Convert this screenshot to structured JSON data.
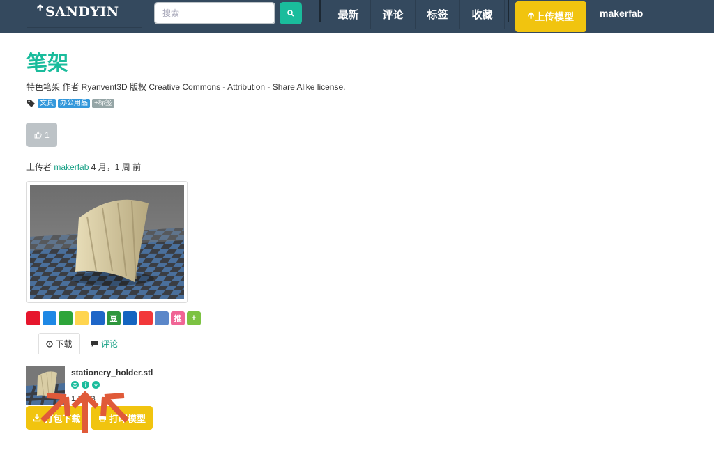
{
  "colors": {
    "navbar": "#34495e",
    "accent": "#1abc9c",
    "upload": "#f1c40f",
    "tag_blue": "#3498db",
    "tag_gray": "#95a5a6",
    "arrow": "#e05a39"
  },
  "header": {
    "logo": "SANDYIN",
    "search_placeholder": "搜索",
    "nav": [
      "最新",
      "评论",
      "标签",
      "收藏"
    ],
    "upload_label": "上传模型",
    "username": "makerfab"
  },
  "model": {
    "title": "笔架",
    "description": "特色笔架 作者 Ryanvent3D 版权 Creative Commons - Attribution - Share Alike license.",
    "tags": [
      "文具",
      "办公用品"
    ],
    "add_tag": "+标签",
    "likes": "1",
    "uploaded_prefix": "上传者",
    "uploader": "makerfab",
    "uploaded_time": "4 月，1 周 前"
  },
  "share": {
    "icons": [
      "weibo-icon",
      "qzone-icon",
      "wechat-icon",
      "qq-icon",
      "star-icon",
      "douban-icon",
      "renren-icon",
      "kaixin-icon",
      "mail-icon",
      "tuita-icon",
      "more-share-icon"
    ],
    "labels": [
      "",
      "",
      "",
      "",
      "",
      "豆",
      "",
      "",
      "",
      "推",
      "+"
    ]
  },
  "tabs": {
    "download": "下载",
    "comments": "评论"
  },
  "file": {
    "name": "stationery_holder.stl",
    "size": "1.1 MB",
    "download_zip_label": "打包下载",
    "print_label": "打印模型"
  }
}
